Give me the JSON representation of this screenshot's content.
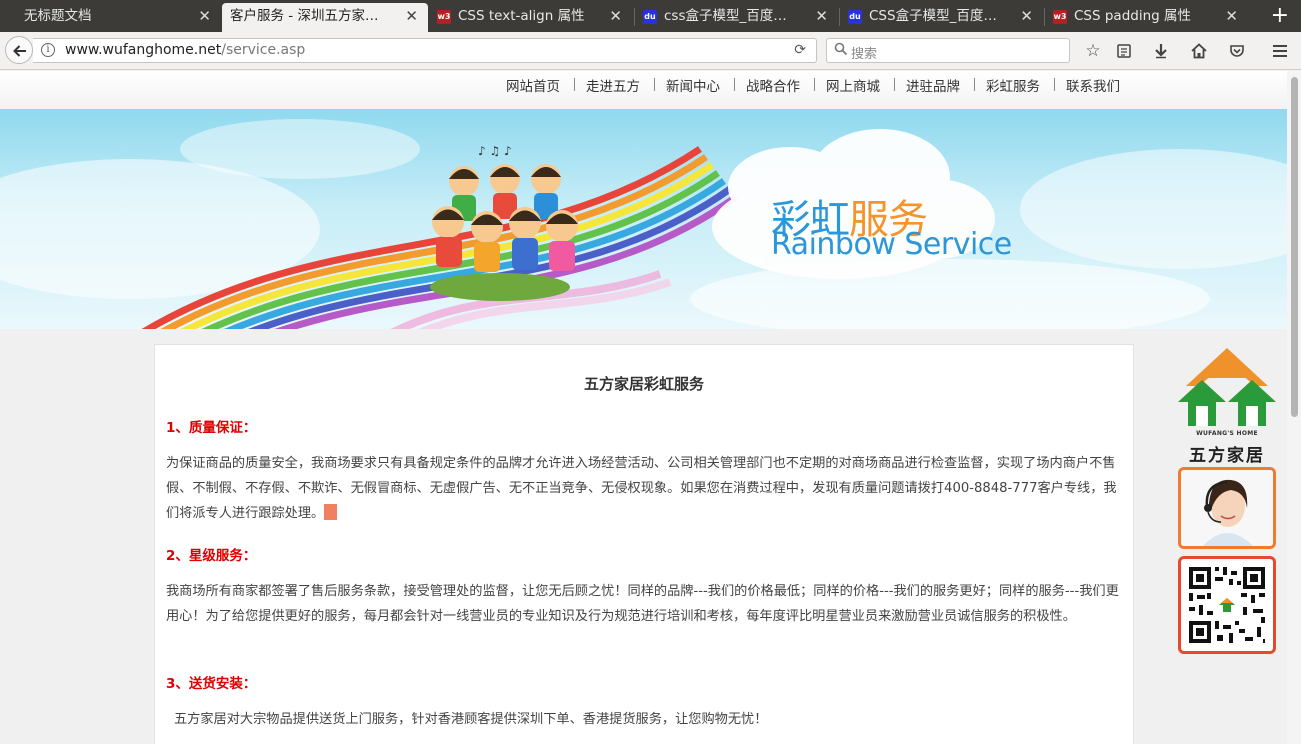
{
  "browser": {
    "tabs": [
      {
        "title": "无标题文档",
        "icon": "none",
        "active": false
      },
      {
        "title": "客户服务 - 深圳五方家…",
        "icon": "none",
        "active": true
      },
      {
        "title": "CSS text-align 属性",
        "icon": "w3school-icon",
        "active": false
      },
      {
        "title": "css盒子模型_百度…",
        "icon": "baidu-icon",
        "active": false
      },
      {
        "title": "CSS盒子模型_百度…",
        "icon": "baidu-icon",
        "active": false
      },
      {
        "title": "CSS padding 属性",
        "icon": "w3school-icon",
        "active": false
      }
    ],
    "close_glyph": "✕",
    "new_tab_glyph": "+",
    "url_host": "www.wufanghome.net",
    "url_path": "/service.asp",
    "search_placeholder": "搜索"
  },
  "site": {
    "nav": [
      "网站首页",
      "走进五方",
      "新闻中心",
      "战略合作",
      "网上商城",
      "进驻品牌",
      "彩虹服务",
      "联系我们"
    ],
    "banner": {
      "title_cn_part1": "彩虹",
      "title_cn_part2": "服务",
      "title_en": "Rainbow Service"
    },
    "content": {
      "title": "五方家居彩虹服务",
      "sections": [
        {
          "heading": "1、质量保证：",
          "body": "为保证商品的质量安全，我商场要求只有具备规定条件的品牌才允许进入场经营活动、公司相关管理部门也不定期的对商场商品进行检查监督，实现了场内商户不售假、不制假、不存假、不欺诈、无假冒商标、无虚假广告、无不正当竞争、无侵权现象。如果您在消费过程中，发现有质量问题请拨打400-8848-777客户专线，我们将派专人进行跟踪处理。"
        },
        {
          "heading": "2、星级服务：",
          "body": "我商场所有商家都签署了售后服务条款，接受管理处的监督，让您无后顾之忧！同样的品牌---我们的价格最低；同样的价格---我们的服务更好；同样的服务---我们更用心！为了给您提供更好的服务，每月都会针对一线营业员的专业知识及行为规范进行培训和考核，每年度评比明星营业员来激励营业员诚信服务的积极性。"
        },
        {
          "heading": "3、送货安装：",
          "body": "五方家居对大宗物品提供送货上门服务，针对香港顾客提供深圳下单、香港提货服务，让您购物无忧！"
        }
      ]
    },
    "side": {
      "logo_en": "WUFANG'S HOME",
      "logo_cn": "五方家居"
    }
  },
  "colors": {
    "accent_red": "#e00000",
    "logo_orange": "#f0922b",
    "logo_green": "#2a9a3a",
    "banner_blue": "#2b96d8"
  }
}
